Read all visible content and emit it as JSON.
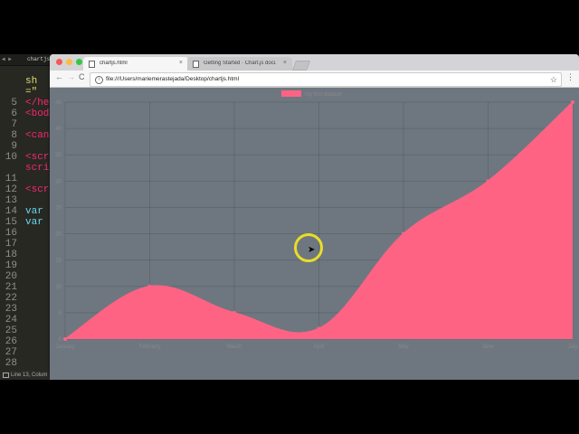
{
  "editor": {
    "tab_label": "chartjs.h",
    "nav_arrows": "◀ ▶",
    "lines": [
      {
        "num": "",
        "code": "sh",
        "color": "#e6db74"
      },
      {
        "num": "",
        "code": "=\"",
        "color": "#e6db74"
      },
      {
        "num": "5",
        "code": "</he",
        "color": "#f92672"
      },
      {
        "num": "6",
        "code": "<bod",
        "color": "#f92672"
      },
      {
        "num": "7",
        "code": "",
        "color": "#f8f8f2"
      },
      {
        "num": "8",
        "code": "<can",
        "color": "#f92672"
      },
      {
        "num": "9",
        "code": "",
        "color": "#f8f8f2"
      },
      {
        "num": "10",
        "code": "<scr",
        "color": "#f92672"
      },
      {
        "num": "",
        "code": "scri",
        "color": "#f92672"
      },
      {
        "num": "11",
        "code": "",
        "color": "#f8f8f2"
      },
      {
        "num": "12",
        "code": "<scr",
        "color": "#f92672"
      },
      {
        "num": "13",
        "code": "",
        "color": "#f8f8f2"
      },
      {
        "num": "14",
        "code": "var",
        "color": "#66d9ef"
      },
      {
        "num": "15",
        "code": "var",
        "color": "#66d9ef"
      },
      {
        "num": "16",
        "code": "",
        "color": "#f8f8f2"
      },
      {
        "num": "17",
        "code": "",
        "color": "#f8f8f2"
      },
      {
        "num": "18",
        "code": "",
        "color": "#f8f8f2"
      },
      {
        "num": "19",
        "code": "",
        "color": "#f8f8f2"
      },
      {
        "num": "20",
        "code": "",
        "color": "#f8f8f2"
      },
      {
        "num": "21",
        "code": "",
        "color": "#f8f8f2"
      },
      {
        "num": "22",
        "code": "",
        "color": "#f8f8f2"
      },
      {
        "num": "23",
        "code": "",
        "color": "#f8f8f2"
      },
      {
        "num": "24",
        "code": "",
        "color": "#f8f8f2"
      },
      {
        "num": "25",
        "code": "",
        "color": "#f8f8f2"
      },
      {
        "num": "26",
        "code": "",
        "color": "#f8f8f2"
      },
      {
        "num": "27",
        "code": "",
        "color": "#f8f8f2"
      },
      {
        "num": "28",
        "code": "",
        "color": "#f8f8f2"
      }
    ],
    "status": "Line 13, Colum"
  },
  "browser": {
    "tabs": [
      {
        "label": "chartjs.html",
        "close": "×",
        "active": true
      },
      {
        "label": "Getting Started · Chart.js docu",
        "close": "×",
        "active": false
      }
    ],
    "traffic_lights": [
      "#fc5753",
      "#fdbc40",
      "#33c748"
    ],
    "nav": {
      "back": "←",
      "forward": "→",
      "reload": "C"
    },
    "url": "file:///Users/mariemerastejada/Desktop/chartjs.html",
    "page_icon": "i",
    "star_icon": "☆",
    "menu_icon": "⋮"
  },
  "cursor_glyph": "➤",
  "chart_data": {
    "type": "area",
    "legend": "My first dataset",
    "legend_position": "top",
    "x": [
      "January",
      "February",
      "March",
      "April",
      "May",
      "June",
      "July"
    ],
    "series": [
      {
        "name": "My first dataset",
        "values": [
          0,
          10,
          5,
          2,
          20,
          30,
          45
        ]
      }
    ],
    "ylim": [
      0,
      45
    ],
    "yticks": [
      0,
      5,
      10,
      15,
      20,
      25,
      30,
      35,
      40,
      45
    ],
    "fill_color": "#ff6384",
    "grid": true
  }
}
